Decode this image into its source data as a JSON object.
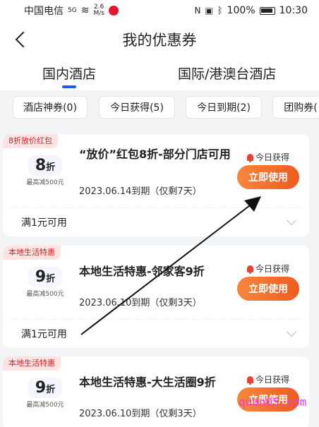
{
  "statusbar": {
    "carrier": "中国电信",
    "net_type": "5G",
    "speed_value": "2.6",
    "speed_unit": "M/s",
    "battery": "100%",
    "time": "10:30"
  },
  "header": {
    "title": "我的优惠券"
  },
  "tabs": [
    {
      "label": "国内酒店",
      "active": true
    },
    {
      "label": "国际/港澳台酒店",
      "active": false
    }
  ],
  "chips": [
    {
      "label": "酒店神券(0)"
    },
    {
      "label": "今日获得(5)"
    },
    {
      "label": "今日到期(2)"
    },
    {
      "label": "团购券("
    }
  ],
  "coupons": [
    {
      "tag": "8折放价红包",
      "discount": "8",
      "unit": "折",
      "max_off": "最高减500元",
      "title": "“放价”红包8折-部分门店可用",
      "expire": "2023.06.14到期（仅剩7天）",
      "today": "今日获得",
      "button": "立即使用",
      "condition": "满1元可用"
    },
    {
      "tag": "本地生活特惠",
      "discount": "9",
      "unit": "折",
      "max_off": "最高减500元",
      "title": "本地生活特惠-邻家客9折",
      "expire": "2023.06.10到期（仅剩3天）",
      "today": "今日获得",
      "button": "立即使用",
      "condition": "满1元可用"
    },
    {
      "tag": "本地生活特惠",
      "discount": "9",
      "unit": "折",
      "max_off": "最高减500元",
      "title": "本地生活特惠-大生活圈9折",
      "expire": "2023.06.10到期（仅剩3天）",
      "today": "今日获得",
      "button": "立即使用",
      "condition": ""
    }
  ],
  "watermark": "quan05.com",
  "colors": {
    "accent_blue": "#1a5ee8",
    "button_orange": "#ef5b1f",
    "tag_bg": "#ffe3e3",
    "tag_text": "#c42a2a",
    "watermark": "#e83cf0"
  }
}
